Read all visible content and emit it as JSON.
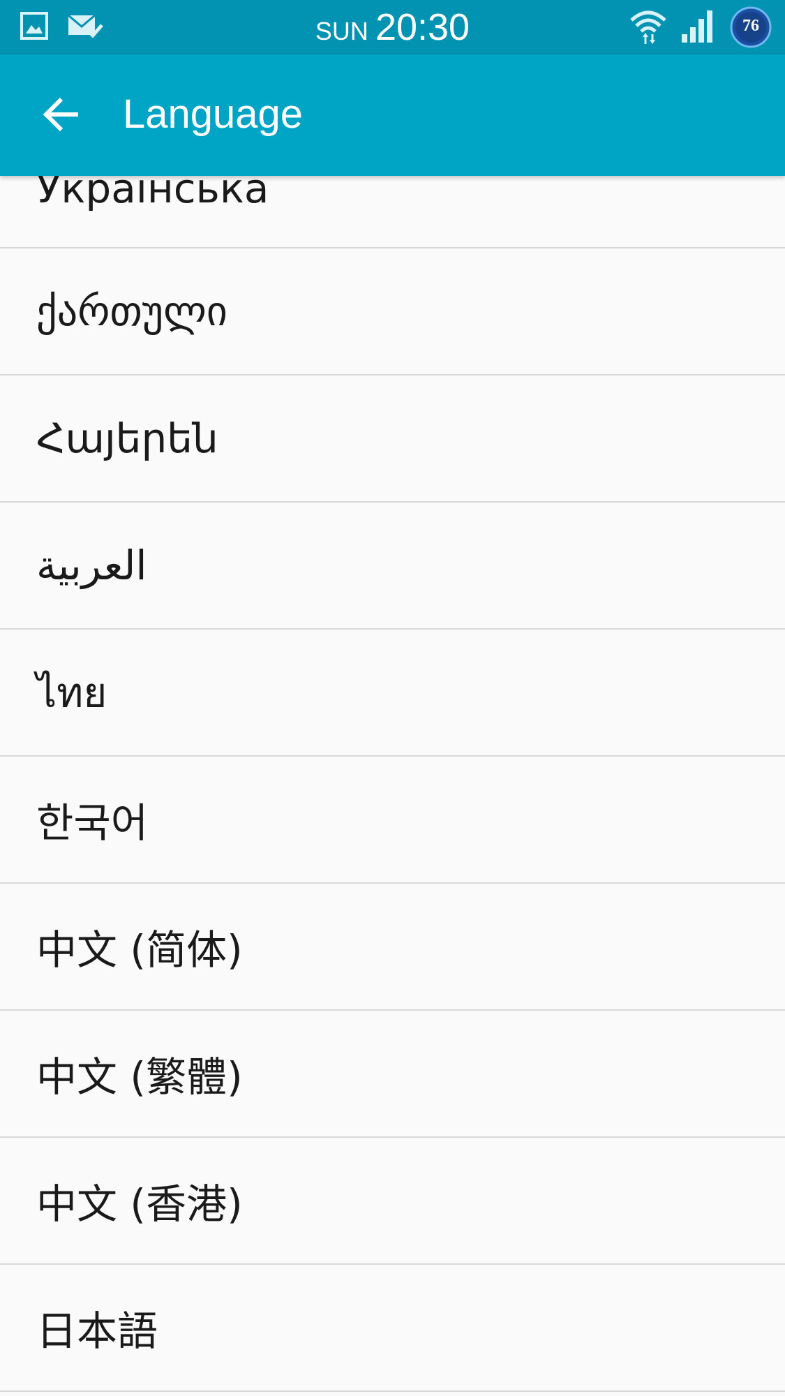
{
  "status_bar": {
    "day": "SUN",
    "time": "20:30",
    "battery_level": "76",
    "icons": [
      "gallery-icon",
      "mail-check-icon",
      "wifi-icon",
      "cell-signal-icon",
      "battery-icon"
    ]
  },
  "app_bar": {
    "title": "Language",
    "back_icon": "back-arrow-icon"
  },
  "languages": [
    {
      "label": "Українська"
    },
    {
      "label": "ქართული"
    },
    {
      "label": "Հայերեն"
    },
    {
      "label": "العربية"
    },
    {
      "label": "ไทย"
    },
    {
      "label": "한국어"
    },
    {
      "label": "中文 (简体)"
    },
    {
      "label": "中文 (繁體)"
    },
    {
      "label": "中文 (香港)"
    },
    {
      "label": "日本語"
    }
  ],
  "colors": {
    "status_bar": "#0393b2",
    "app_bar": "#00a5c5",
    "background": "#fafafa",
    "divider": "#d9d9d9",
    "text": "#1a1a1a"
  }
}
